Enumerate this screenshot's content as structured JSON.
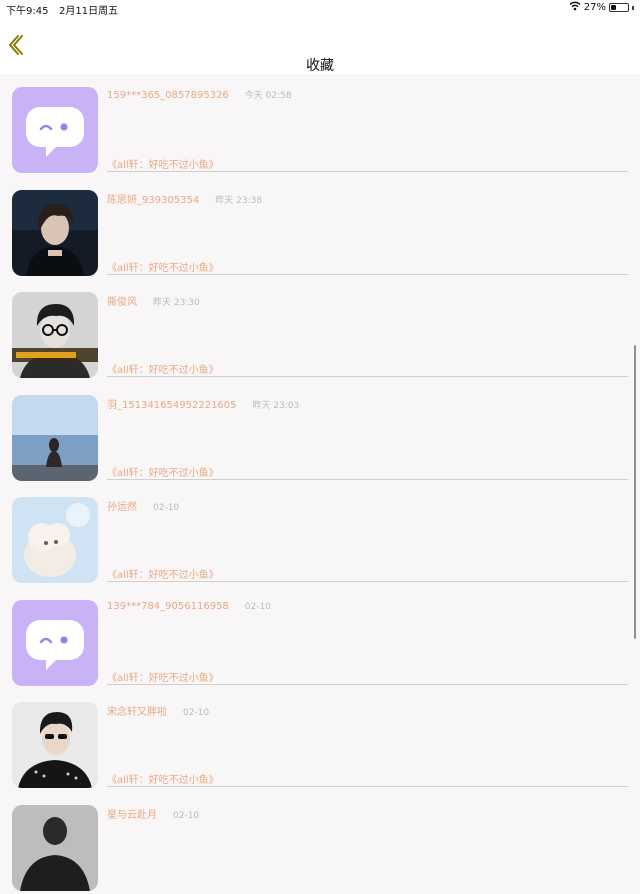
{
  "status_bar": {
    "time": "下午9:45",
    "date": "2月11日周五",
    "battery": "27%",
    "battery_level": 0.27
  },
  "nav": {
    "title": "收藏",
    "back_icon": "chevron-left-icon",
    "accent_color": "#8a7a00"
  },
  "favorites": [
    {
      "name": "159***365_0857895326",
      "time": "今天 02:58",
      "quote": "《all轩：好吃不过小鱼》",
      "avatar": "default-chat-avatar"
    },
    {
      "name": "陈思妍_939305354",
      "time": "昨天 23:38",
      "quote": "《all轩：好吃不过小鱼》",
      "avatar": "photo-boy-dark"
    },
    {
      "name": "撕俊风",
      "time": "昨天 23:30",
      "quote": "《all轩：好吃不过小鱼》",
      "avatar": "photo-boy-glasses"
    },
    {
      "name": "羽_151341654952221605",
      "time": "昨天 23:03",
      "quote": "《all轩：好吃不过小鱼》",
      "avatar": "photo-girl-sea"
    },
    {
      "name": "孙运然",
      "time": "02-10",
      "quote": "《all轩：好吃不过小鱼》",
      "avatar": "photo-plush-sheep"
    },
    {
      "name": "139***784_9056116958",
      "time": "02-10",
      "quote": "《all轩：好吃不过小鱼》",
      "avatar": "default-chat-avatar"
    },
    {
      "name": "宋念轩又胖啦",
      "time": "02-10",
      "quote": "《all轩：好吃不过小鱼》",
      "avatar": "photo-boy-sunglasses"
    },
    {
      "name": "星与云赴月",
      "time": "02-10",
      "quote": "",
      "avatar": "photo-person-dark"
    }
  ],
  "colors": {
    "name_text": "#e8a983",
    "time_text": "#bbbbbb",
    "default_avatar_bg": "#c9b2f5"
  }
}
